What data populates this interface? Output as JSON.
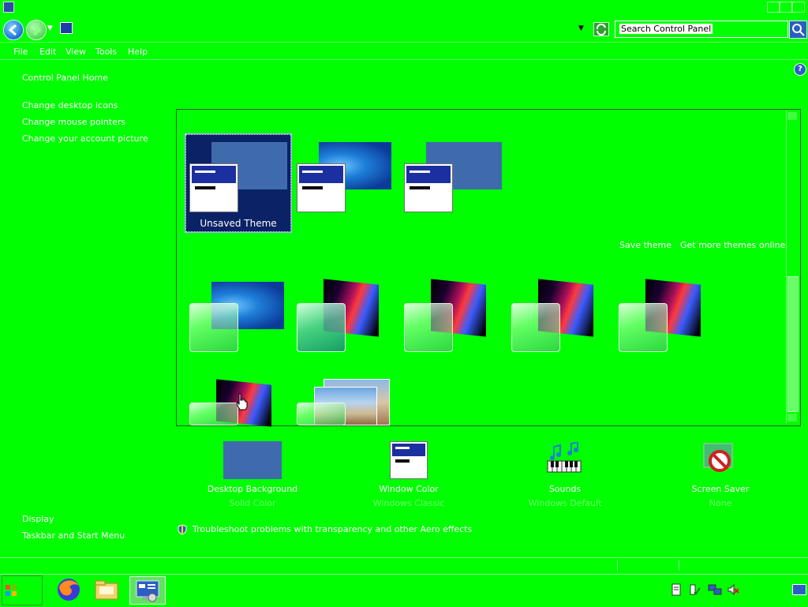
{
  "toolbar": {
    "menu": [
      "File",
      "Edit",
      "View",
      "Tools",
      "Help"
    ],
    "search_placeholder": "Search Control Panel"
  },
  "sidebar": {
    "home": "Control Panel Home",
    "tasks": [
      "Change desktop icons",
      "Change mouse pointers",
      "Change your account picture"
    ],
    "see_also": [
      "Display",
      "Taskbar and Start Menu"
    ]
  },
  "themes": {
    "selected_theme_label": "Unsaved Theme",
    "save_theme": "Save theme",
    "get_more_online": "Get more themes online"
  },
  "settings": [
    {
      "label": "Desktop Background",
      "value": "Solid Color"
    },
    {
      "label": "Window Color",
      "value": "Windows Classic"
    },
    {
      "label": "Sounds",
      "value": "Windows Default"
    },
    {
      "label": "Screen Saver",
      "value": "None"
    }
  ],
  "troubleshoot": "Troubleshoot problems with transparency and other Aero effects",
  "colors": {
    "background": "#00ff00",
    "text": "#ffffff",
    "selection": "#0b2266"
  },
  "icons": {
    "back": "back-arrow-icon",
    "forward": "forward-arrow-icon",
    "help": "help-icon",
    "search": "search-icon",
    "refresh": "refresh-icon"
  }
}
